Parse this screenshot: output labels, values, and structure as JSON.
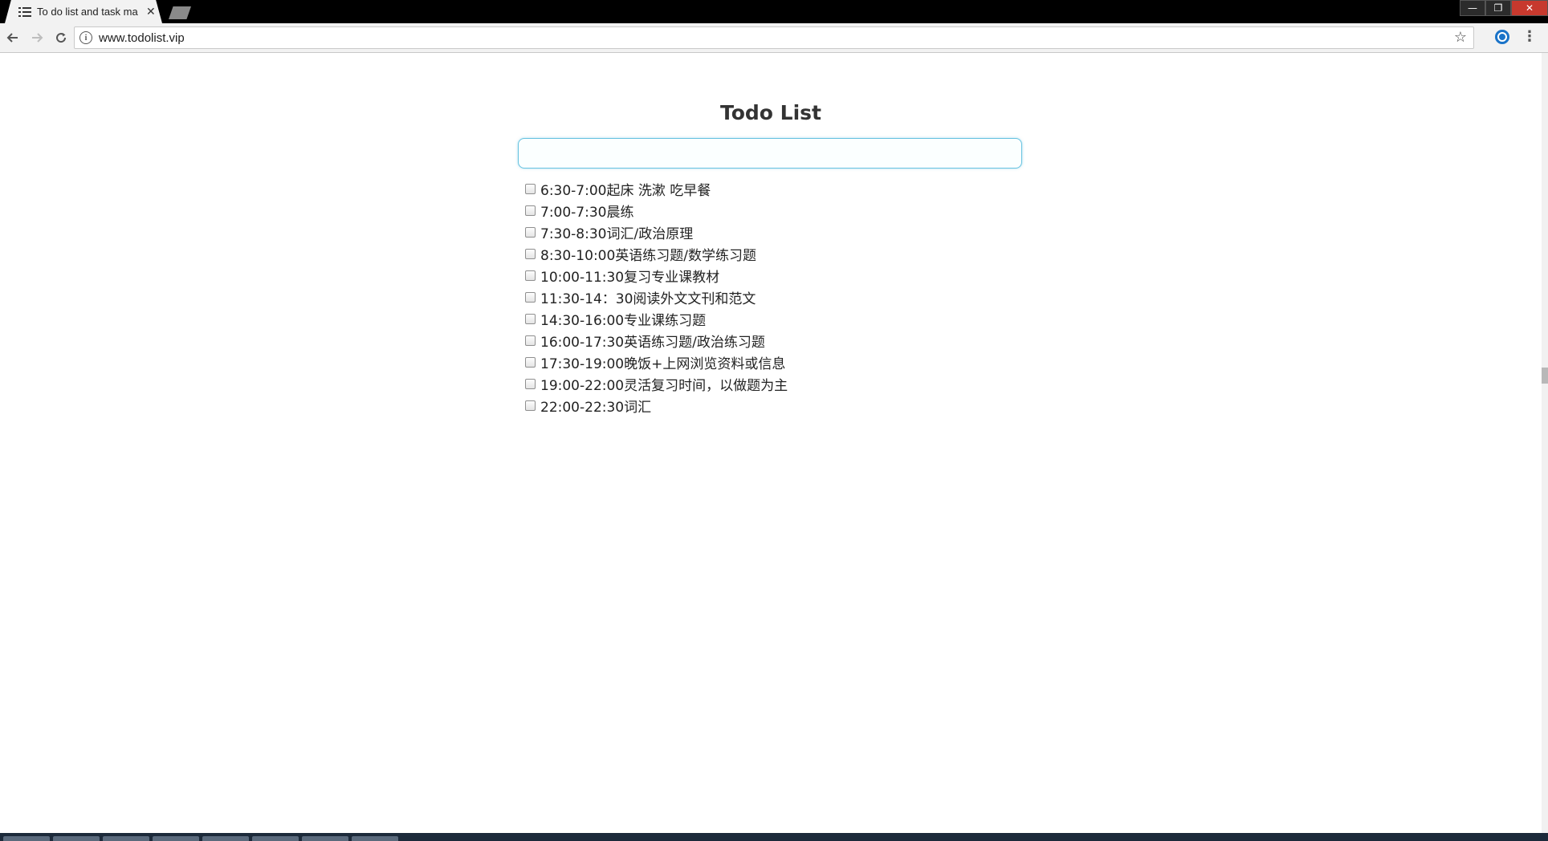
{
  "browser": {
    "tab_title": "To do list and task ma",
    "url": "www.todolist.vip",
    "window_controls": [
      "—",
      "❐",
      "✕"
    ]
  },
  "page": {
    "title": "Todo List",
    "input_placeholder": "",
    "todos": [
      {
        "label": "6:30-7:00起床 洗漱 吃早餐",
        "checked": false
      },
      {
        "label": "7:00-7:30晨练",
        "checked": false
      },
      {
        "label": "7:30-8:30词汇/政治原理",
        "checked": false
      },
      {
        "label": "8:30-10:00英语练习题/数学练习题",
        "checked": false
      },
      {
        "label": "10:00-11:30复习专业课教材",
        "checked": false
      },
      {
        "label": "11:30-14：30阅读外文文刊和范文",
        "checked": false
      },
      {
        "label": "14:30-16:00专业课练习题",
        "checked": false
      },
      {
        "label": "16:00-17:30英语练习题/政治练习题",
        "checked": false
      },
      {
        "label": "17:30-19:00晚饭+上网浏览资料或信息",
        "checked": false
      },
      {
        "label": "19:00-22:00灵活复习时间，以做题为主",
        "checked": false
      },
      {
        "label": "22:00-22:30词汇",
        "checked": false
      }
    ]
  },
  "colors": {
    "input_border": "#66c2e0",
    "title_text": "#333333"
  }
}
